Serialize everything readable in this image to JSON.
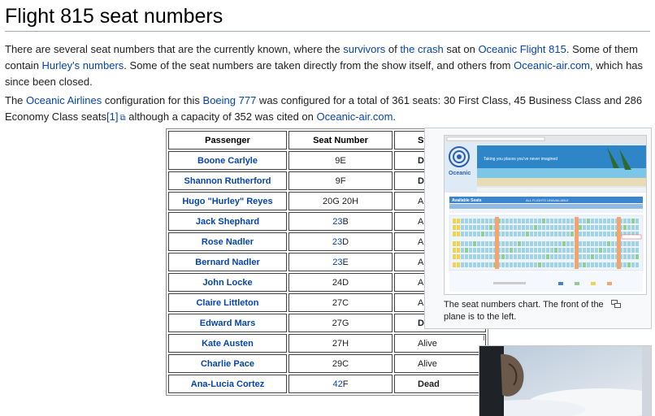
{
  "heading": "Flight 815 seat numbers",
  "p1": {
    "t1": "There are several seat numbers that are the currently known, where the ",
    "l1": "survivors",
    "t2": " of ",
    "l2": "the crash",
    "t3": " sat on ",
    "l3": "Oceanic Flight 815",
    "t4": ". Some of them contain ",
    "l4": "Hurley's numbers",
    "t5": ". Some of the seat numbers are taken directly from the show itself, and others from ",
    "l5": "Oceanic-air.com",
    "t6": ", which has since been closed."
  },
  "p2": {
    "t1": "The ",
    "l1": "Oceanic Airlines",
    "t2": " configuration for this ",
    "l2": "Boeing 777",
    "t3": " was configured for a total of 361 seats: 30 First Class, 45 Business Class and 286 Economy Class seats",
    "l3": "[1]",
    "t4": " although a capacity of 352 was cited on ",
    "l4": "Oceanic-air.com",
    "t5": "."
  },
  "table": {
    "headers": [
      "Passenger",
      "Seat Number",
      "Sta"
    ],
    "rows": [
      {
        "name": "Boone Carlyle",
        "seat_pre": "",
        "seat_link": "",
        "seat": "9E",
        "status": "Dea"
      },
      {
        "name": "Shannon Rutherford",
        "seat_pre": "",
        "seat_link": "",
        "seat": "9F",
        "status": "Dea"
      },
      {
        "name": "Hugo \"Hurley\" Reyes",
        "seat_pre": "",
        "seat_link": "",
        "seat": "20G 20H",
        "status": "Alive"
      },
      {
        "name": "Jack Shephard",
        "seat_pre": "",
        "seat_link": "23",
        "seat": "B",
        "status": "Alive"
      },
      {
        "name": "Rose Nadler",
        "seat_pre": "",
        "seat_link": "23",
        "seat": "D",
        "status": "Alive"
      },
      {
        "name": "Bernard Nadler",
        "seat_pre": "",
        "seat_link": "23",
        "seat": "E",
        "status": "Alive"
      },
      {
        "name": "John Locke",
        "seat_pre": "",
        "seat_link": "",
        "seat": "24D",
        "status": "Alive"
      },
      {
        "name": "Claire Littleton",
        "seat_pre": "",
        "seat_link": "",
        "seat": "27C",
        "status": "Alive"
      },
      {
        "name": "Edward Mars",
        "seat_pre": "",
        "seat_link": "",
        "seat": "27G",
        "status": "Dea"
      },
      {
        "name": "Kate Austen",
        "seat_pre": "",
        "seat_link": "",
        "seat": "27H",
        "status": "Alive"
      },
      {
        "name": "Charlie Pace",
        "seat_pre": "",
        "seat_link": "",
        "seat": "29C",
        "status": "Alive"
      },
      {
        "name": "Ana-Lucia Cortez",
        "seat_pre": "",
        "seat_link": "42",
        "seat": "F",
        "status": "Dead"
      }
    ]
  },
  "thumb": {
    "caption": "The seat numbers chart. The front of the plane is to the left.",
    "site_brand": "Oceanic",
    "site_tagline": "Taking you places you've never imagined",
    "panel_title": "Available Seats",
    "panel_sub": "ALL FLIGHTS UNAVAILABLE"
  },
  "pause_glyph": "II",
  "colors": {
    "link": "#0645ad",
    "border": "#c8ccd1"
  }
}
